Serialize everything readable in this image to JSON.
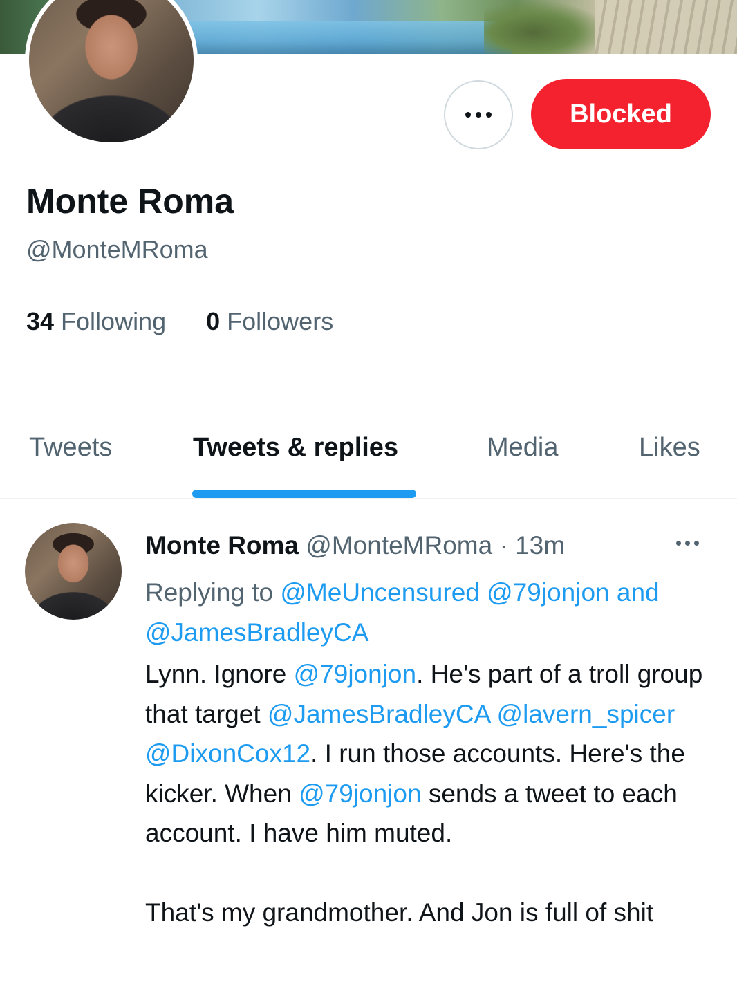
{
  "profile": {
    "display_name": "Monte Roma",
    "handle": "@MonteMRoma",
    "blocked_label": "Blocked",
    "following_count": "34",
    "following_label": "Following",
    "followers_count": "0",
    "followers_label": "Followers"
  },
  "tabs": [
    {
      "label": "Tweets",
      "active": false
    },
    {
      "label": "Tweets & replies",
      "active": true
    },
    {
      "label": "Media",
      "active": false
    },
    {
      "label": "Likes",
      "active": false
    }
  ],
  "tweet": {
    "author": "Monte Roma",
    "handle": "@MonteMRoma",
    "separator": "·",
    "time": "13m",
    "replying_prefix": "Replying to",
    "reply_to_1": "@MeUncensured",
    "reply_to_2": "@79jonjon",
    "reply_and": "and",
    "reply_to_3": "@JamesBradleyCA",
    "body": {
      "t1": "Lynn. Ignore ",
      "m1": "@79jonjon",
      "t2": ". He's part of a troll group that target ",
      "m2": "@JamesBradleyCA",
      "m3": "@lavern_spicer",
      "m4": "@DixonCox12",
      "t3": ". I run those accounts. Here's the kicker. When ",
      "m5": "@79jonjon",
      "t4": " sends a tweet to each account. I have him muted.",
      "p2": "That's my grandmother. And Jon is full of shit"
    }
  },
  "colors": {
    "blocked": "#f4212e",
    "link": "#1d9bf0",
    "secondary_text": "#536471",
    "primary_text": "#0f1419"
  }
}
